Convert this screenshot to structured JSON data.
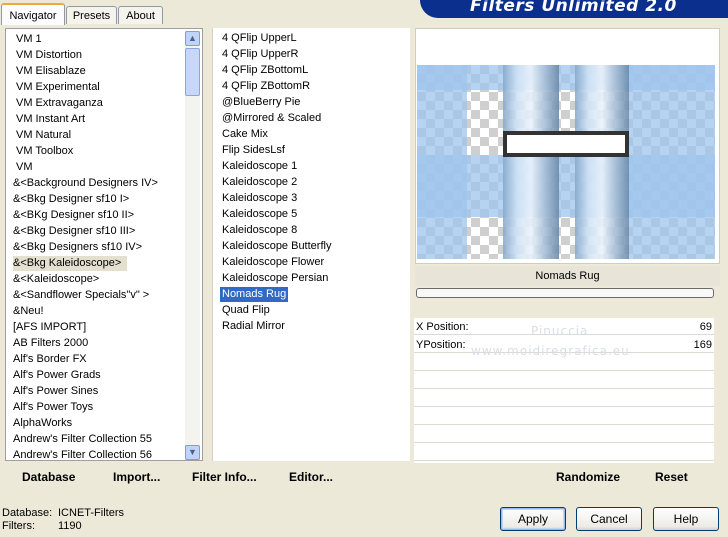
{
  "window": {
    "title": "Filters Unlimited 2.0"
  },
  "tabs": [
    "Navigator",
    "Presets",
    "About"
  ],
  "categories": [
    "VM 1",
    "VM Distortion",
    "VM Elisablaze",
    "VM Experimental",
    "VM Extravaganza",
    "VM Instant Art",
    "VM Natural",
    "VM Toolbox",
    "VM",
    "&<Background Designers IV>",
    "&<Bkg Designer sf10 I>",
    "&<BKg Designer sf10 II>",
    "&<Bkg Designer sf10 III>",
    "&<Bkg Designers sf10 IV>",
    "&<Bkg Kaleidoscope>",
    "&<Kaleidoscope>",
    "&<Sandflower Specials\"v\" >",
    "&Neu!",
    "[AFS IMPORT]",
    "AB Filters 2000",
    "Alf's Border FX",
    "Alf's Power Grads",
    "Alf's Power Sines",
    "Alf's Power Toys",
    "AlphaWorks",
    "Andrew's Filter Collection 55",
    "Andrew's Filter Collection 56"
  ],
  "selected_category": "&<Bkg Kaleidoscope>",
  "filters": [
    "4 QFlip UpperL",
    "4 QFlip UpperR",
    "4 QFlip ZBottomL",
    "4 QFlip ZBottomR",
    "@BlueBerry Pie",
    "@Mirrored & Scaled",
    "Cake Mix",
    "Flip SidesLsf",
    "Kaleidoscope 1",
    "Kaleidoscope 2",
    "Kaleidoscope 3",
    "Kaleidoscope 5",
    "Kaleidoscope 8",
    "Kaleidoscope Butterfly",
    "Kaleidoscope Flower",
    "Kaleidoscope Persian",
    "Nomads Rug",
    "Quad Flip",
    "Radial Mirror"
  ],
  "selected_filter": "Nomads Rug",
  "preview": {
    "filter_name": "Nomads Rug"
  },
  "params": [
    {
      "label": "X Position:",
      "value": "69"
    },
    {
      "label": "YPosition:",
      "value": "169"
    }
  ],
  "watermark": {
    "line1": "Pinuccia",
    "line2": "www.moidiregrafica.eu"
  },
  "toolbar": {
    "database": "Database",
    "import": "Import...",
    "filter_info": "Filter Info...",
    "editor": "Editor...",
    "randomize": "Randomize",
    "reset": "Reset"
  },
  "status": {
    "database_label": "Database:",
    "database_value": "ICNET-Filters",
    "filters_label": "Filters:",
    "filters_value": "1190"
  },
  "buttons": {
    "apply": "Apply",
    "cancel": "Cancel",
    "help": "Help"
  },
  "colors": {
    "selection": "#316ac5",
    "banner": "#0a2f8c",
    "tab_accent": "#f0a838"
  }
}
